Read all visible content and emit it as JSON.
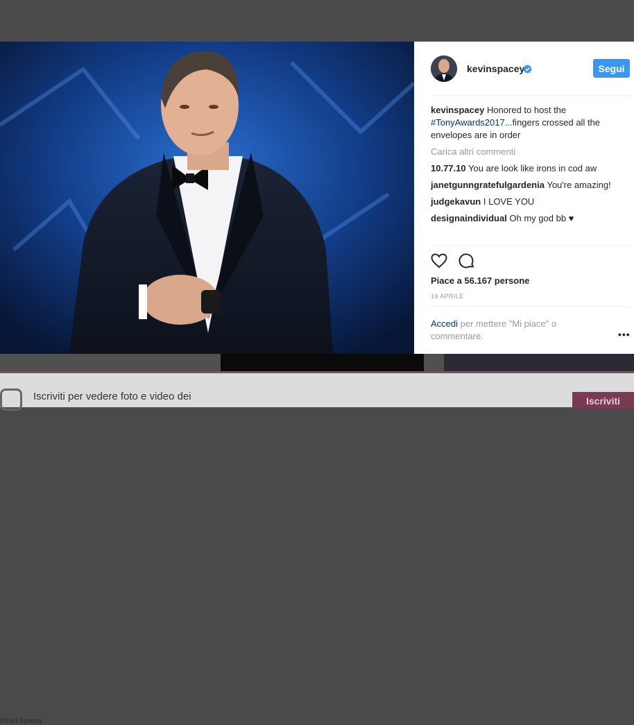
{
  "post": {
    "username": "kevinspacey",
    "follow_label": "Segui",
    "caption": {
      "user": "kevinspacey",
      "text_before": " Honored to host the ",
      "hashtag": "#TonyAwards2017",
      "text_after": "...fingers crossed all the envelopes are in order"
    },
    "load_more_label": "Carica altri commenti",
    "comments": [
      {
        "user": "10.77.10",
        "text": " You are look like irons in cod aw"
      },
      {
        "user": "janetgunngratefulgardenia",
        "text": " You're amazing!"
      },
      {
        "user": "judgekavun",
        "text": " I LOVE YOU"
      },
      {
        "user": "designaindividual",
        "text": " Oh my god bb ♥"
      }
    ],
    "likes_text": "Piace a 56.167 persone",
    "date": "19 APRILE",
    "login_link": "Accedi",
    "login_rest": " per mettere \"Mi piace\" o commentare.",
    "more_label": "•••"
  },
  "background": {
    "caption": "Kevin Spacey"
  },
  "signup_bar": {
    "text": "Iscriviti per vedere foto e video dei",
    "button_label": "Iscriviti"
  },
  "colors": {
    "accent": "#3897f0",
    "link": "#003569",
    "muted": "#999999"
  },
  "icons": [
    "verified-badge-icon",
    "heart-icon",
    "comment-icon",
    "instagram-logo-icon"
  ]
}
